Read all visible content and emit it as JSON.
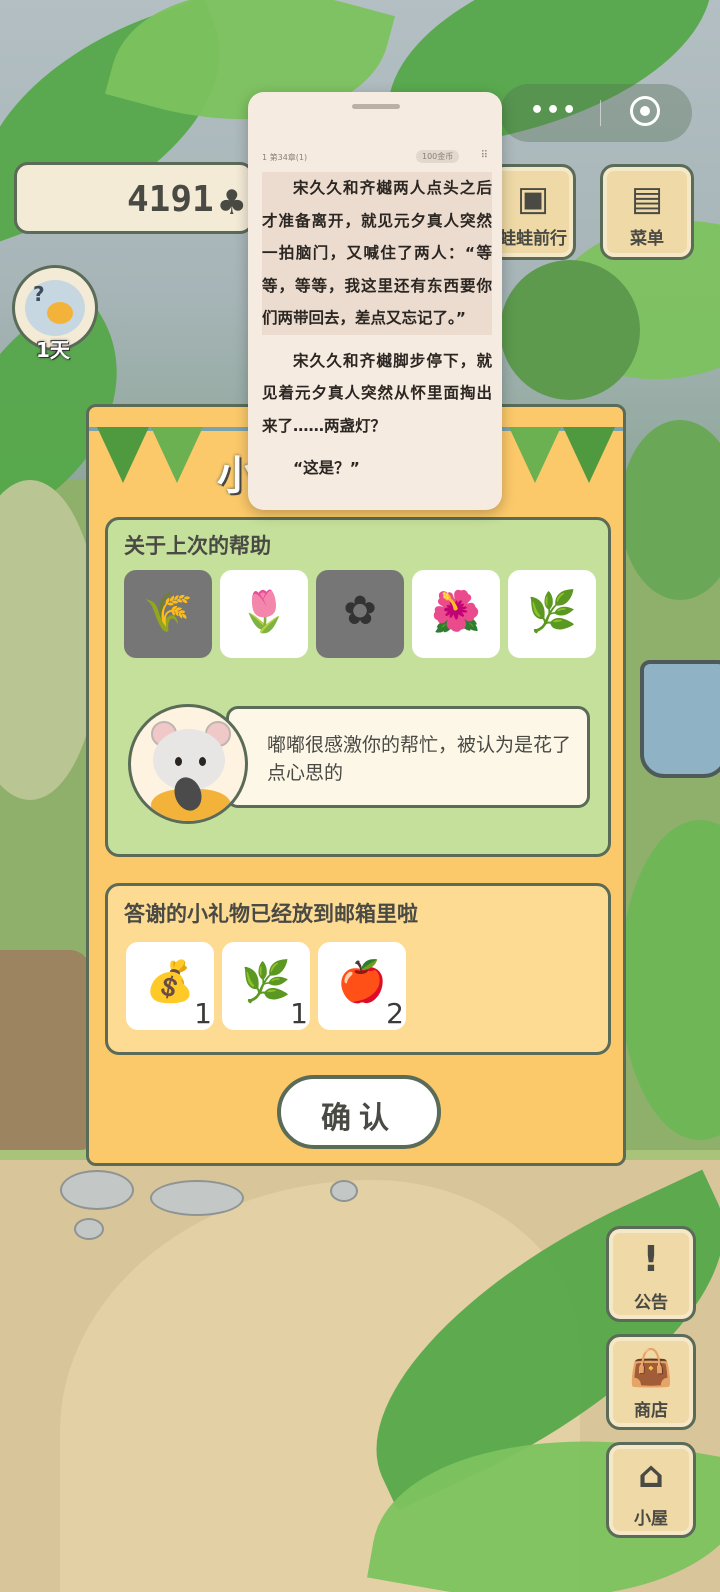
{
  "hud": {
    "coins": "4191",
    "coin_icon": "clover-icon",
    "day_label": "1天",
    "day_icon_text": "?"
  },
  "capsule": {
    "more": "•••",
    "close": "target"
  },
  "top_buttons": {
    "frog": "蛙蛙前行",
    "menu": "菜单"
  },
  "reader": {
    "chapter": "1 第34章(1)",
    "coin_tag": "100金币",
    "grid": "⠿",
    "paragraphs": [
      "宋久久和齐樾两人点头之后才准备离开，就见元夕真人突然一拍脑门，又喊住了两人：“等等，等等，我这里还有东西要你们两带回去，差点又忘记了。”",
      "宋久久和齐樾脚步停下，就见着元夕真人突然从怀里面掏出来了……两盏灯？",
      "“这是？”"
    ]
  },
  "dialog": {
    "title": "小",
    "help_title": "关于上次的帮助",
    "items": [
      {
        "icon": "dark-flower-stalk",
        "glyph": "🌾",
        "collected": false
      },
      {
        "icon": "pink-flower-sprig",
        "glyph": "🌷",
        "collected": true
      },
      {
        "icon": "dark-clover-flower",
        "glyph": "✿",
        "collected": false
      },
      {
        "icon": "pink-hibiscus",
        "glyph": "🌺",
        "collected": true
      },
      {
        "icon": "green-sprig",
        "glyph": "🌿",
        "collected": true
      }
    ],
    "speech": "嘟嘟很感激你的帮忙，被认为是花了点心思的",
    "gift_title": "答谢的小礼物已经放到邮箱里啦",
    "gifts": [
      {
        "icon": "seed-bag-icon",
        "glyph": "💰",
        "count": "1"
      },
      {
        "icon": "green-sprig-icon",
        "glyph": "🌿",
        "count": "1"
      },
      {
        "icon": "apple-icon",
        "glyph": "🍎",
        "count": "2"
      }
    ],
    "confirm": "确认"
  },
  "side_buttons": {
    "notice": "公告",
    "shop": "商店",
    "house": "小屋"
  },
  "colors": {
    "dialog_bg": "#fcc96a",
    "help_bg": "#c5e09b",
    "gift_bg": "#fedb92",
    "outline": "#5a6b58"
  }
}
